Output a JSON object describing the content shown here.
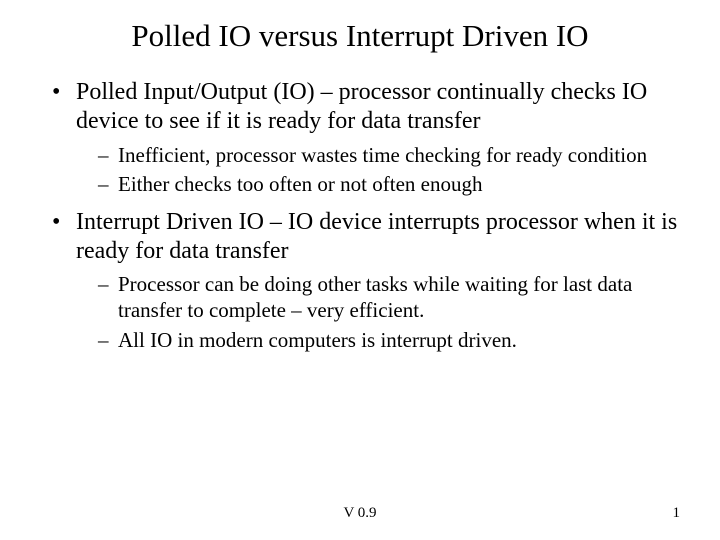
{
  "title": "Polled IO versus Interrupt Driven IO",
  "bullets": [
    {
      "text": "Polled Input/Output (IO) – processor continually checks IO device to see if it is ready for data transfer",
      "sub": [
        "Inefficient, processor wastes time checking for ready condition",
        "Either checks too often or not often enough"
      ]
    },
    {
      "text": "Interrupt Driven IO – IO device interrupts processor when it is ready for data transfer",
      "sub": [
        "Processor can be doing other tasks while waiting for last data transfer to complete – very efficient.",
        "All IO in modern computers is interrupt driven."
      ]
    }
  ],
  "footer": {
    "version": "V 0.9",
    "page": "1"
  }
}
